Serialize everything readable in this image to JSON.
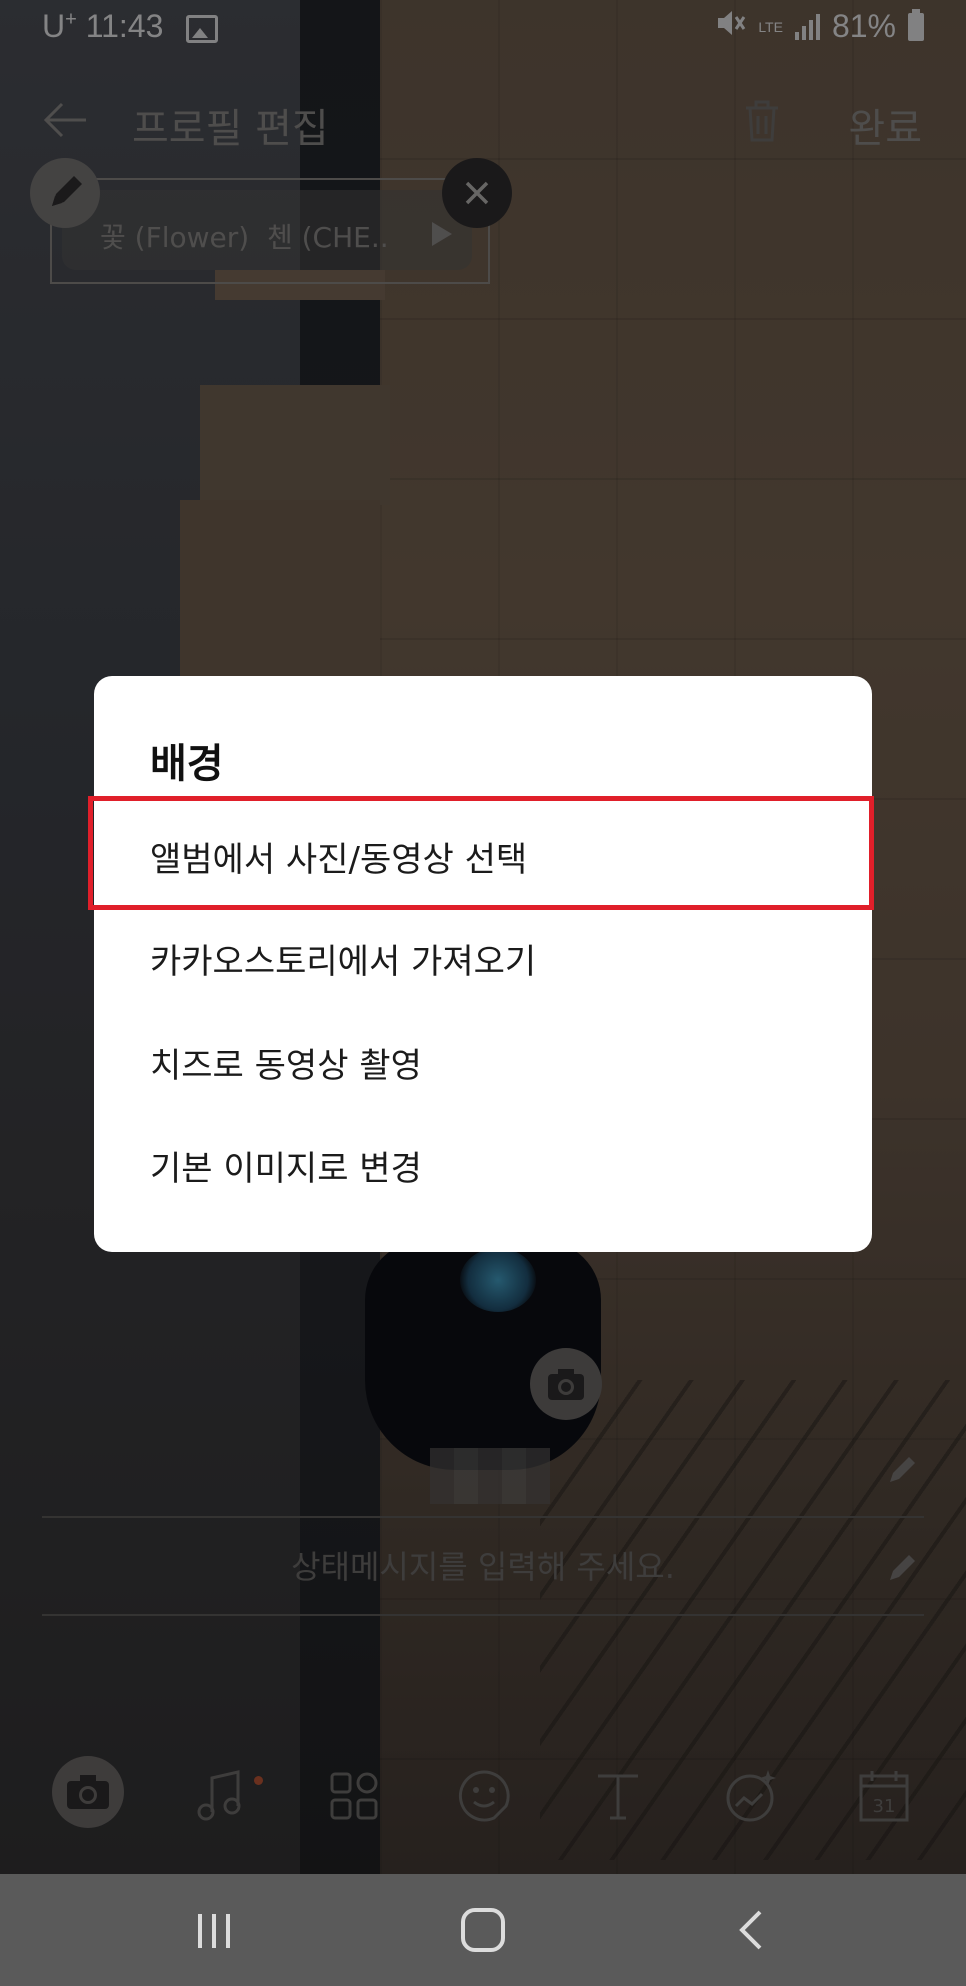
{
  "status_bar": {
    "carrier": "U",
    "carrier_sup": "+",
    "time": "11:43",
    "network": "LTE",
    "battery": "81%"
  },
  "header": {
    "title": "프로필 편집",
    "done_label": "완료",
    "icons": [
      "back-arrow-icon",
      "trash-icon"
    ]
  },
  "music": {
    "text": "꽃 (Flower)  첸 (CHE.."
  },
  "profile": {
    "status_message_placeholder": "상태메시지를 입력해 주세요."
  },
  "dialog": {
    "title": "배경",
    "options": [
      "앨범에서 사진/동영상 선택",
      "카카오스토리에서 가져오기",
      "치즈로 동영상 촬영",
      "기본 이미지로 변경"
    ],
    "highlight_color": "#e01f2a"
  },
  "toolbar": {
    "icons": [
      "camera-icon",
      "music-note-icon",
      "grid-icon",
      "sticker-icon",
      "text-icon",
      "effect-icon",
      "calendar-icon"
    ],
    "calendar_day": "31"
  },
  "nav_bar": {
    "icons": [
      "recent-apps-icon",
      "home-icon",
      "back-icon"
    ]
  }
}
